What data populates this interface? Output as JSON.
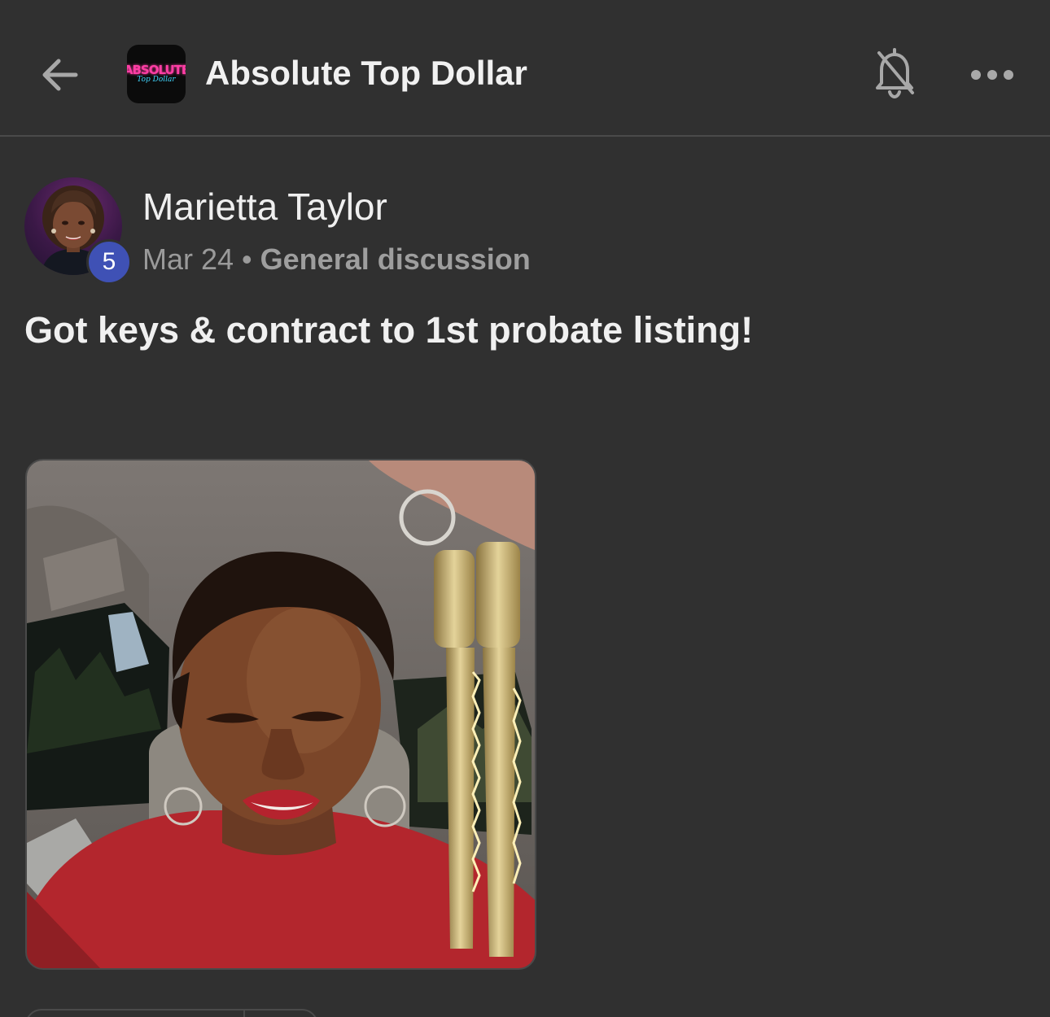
{
  "header": {
    "group_name": "Absolute Top Dollar",
    "logo_text": "ABSOLUTE",
    "logo_subtext": "Top Dollar",
    "icons": {
      "back": "arrow-left-icon",
      "notifications": "bell-off-icon",
      "more": "more-horizontal-icon"
    }
  },
  "post": {
    "author": {
      "name": "Marietta Taylor",
      "level_badge": "5"
    },
    "date": "Mar 24",
    "separator": "•",
    "category": "General discussion",
    "title": "Got keys & contract to 1st probate listing!"
  },
  "colors": {
    "background": "#303030",
    "text": "#ededed",
    "muted_text": "#9a9a9a",
    "badge": "#3f51b5",
    "divider": "#4a4a4a"
  }
}
